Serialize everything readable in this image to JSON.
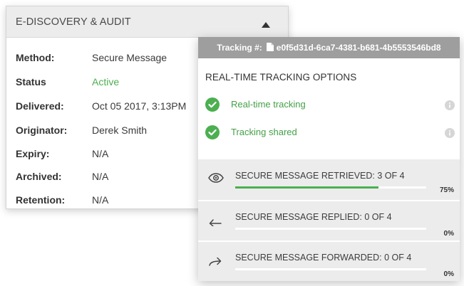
{
  "audit": {
    "title": "E-DISCOVERY & AUDIT",
    "rows": [
      {
        "label": "Method:",
        "value": "Secure Message"
      },
      {
        "label": "Status",
        "value": "Active"
      },
      {
        "label": "Delivered:",
        "value": "Oct 05 2017, 3:13PM"
      },
      {
        "label": "Originator:",
        "value": "Derek Smith"
      },
      {
        "label": "Expiry:",
        "value": "N/A"
      },
      {
        "label": "Archived:",
        "value": "N/A"
      },
      {
        "label": "Retention:",
        "value": "N/A"
      }
    ]
  },
  "tracking": {
    "label": "Tracking #:",
    "id": "e0f5d31d-6ca7-4381-b681-4b5553546bd8",
    "section_title": "REAL-TIME TRACKING OPTIONS",
    "options": [
      {
        "label": "Real-time tracking",
        "checked": true
      },
      {
        "label": "Tracking shared",
        "checked": true
      }
    ],
    "stats": [
      {
        "icon": "eye-icon",
        "label": "SECURE MESSAGE RETRIEVED:",
        "count": "3 OF 4",
        "percent": "75%",
        "progress": 0.75
      },
      {
        "icon": "reply-arrow-icon",
        "label": "SECURE MESSAGE REPLIED:",
        "count": "0 OF 4",
        "percent": "0%",
        "progress": 0
      },
      {
        "icon": "forward-arrow-icon",
        "label": "SECURE MESSAGE FORWARDED:",
        "count": "0 OF 4",
        "percent": "0%",
        "progress": 0
      }
    ]
  },
  "colors": {
    "accent_green": "#4caf50",
    "header_gray": "#9e9e9e",
    "panel_gray": "#ececec"
  }
}
